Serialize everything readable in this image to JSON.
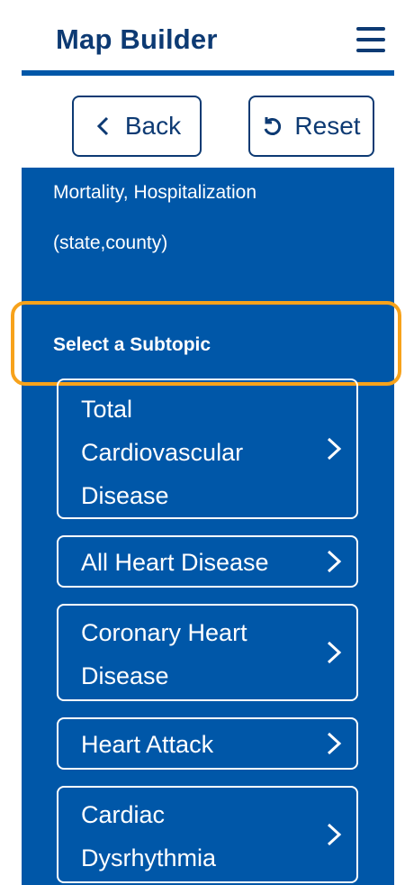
{
  "header": {
    "title": "Map Builder"
  },
  "toolbar": {
    "back_label": "Back",
    "reset_label": "Reset"
  },
  "topic": {
    "line1": "Mortality, Hospitalization",
    "line2": "(state,county)"
  },
  "subtopic": {
    "heading": "Select a Subtopic",
    "items": [
      {
        "label": "Total Cardiovascular Disease"
      },
      {
        "label": "All Heart Disease"
      },
      {
        "label": "Coronary Heart Disease"
      },
      {
        "label": "Heart Attack"
      },
      {
        "label": "Cardiac Dysrhythmia"
      }
    ]
  },
  "colors": {
    "primary": "#0057a8",
    "header_text": "#0d3a73",
    "highlight": "#f7a21b"
  },
  "icons": {
    "menu": "hamburger-menu-icon",
    "back": "chevron-left-icon",
    "reset": "undo-icon",
    "item": "chevron-right-icon"
  }
}
